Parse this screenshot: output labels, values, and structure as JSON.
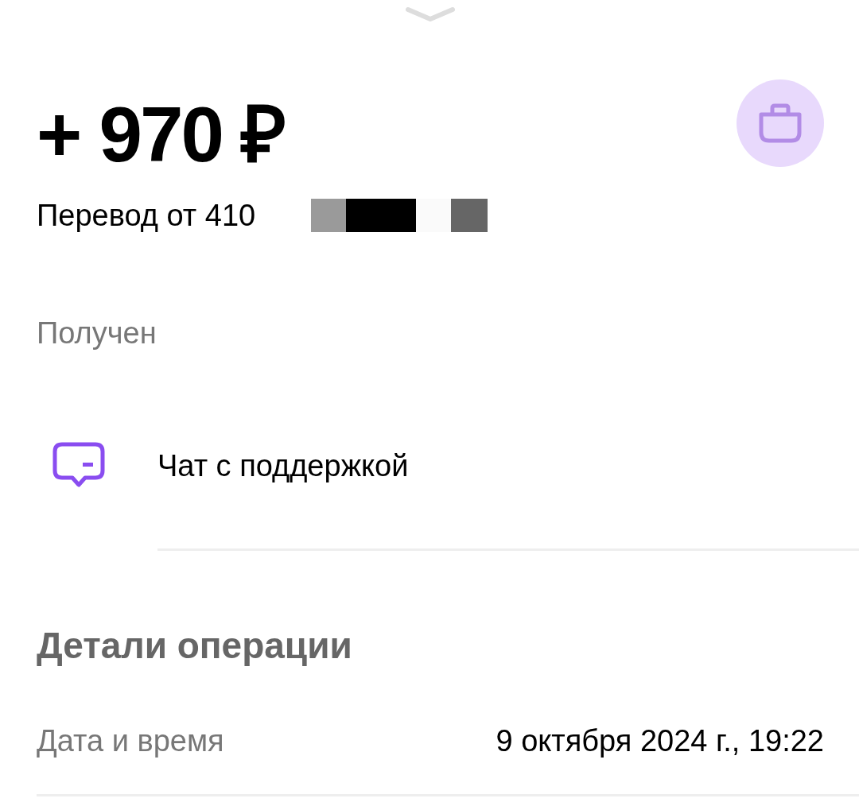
{
  "amount": "+ 970 ₽",
  "subtitle": "Перевод от 410",
  "status": "Получен",
  "support": {
    "label": "Чат с поддержкой"
  },
  "details": {
    "title": "Детали операции",
    "rows": [
      {
        "label": "Дата и время",
        "value": "9 октября 2024 г., 19:22"
      }
    ]
  }
}
